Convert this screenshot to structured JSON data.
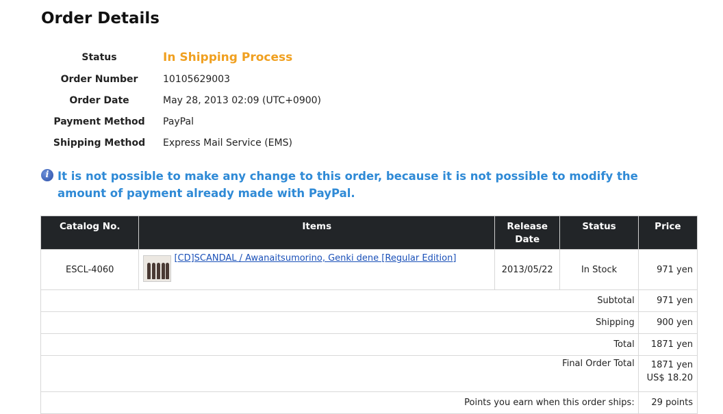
{
  "page": {
    "title": "Order Details"
  },
  "order": {
    "status_label": "Status",
    "status_value": "In Shipping Process",
    "number_label": "Order Number",
    "number_value": "10105629003",
    "date_label": "Order Date",
    "date_value": "May 28, 2013 02:09 (UTC+0900)",
    "payment_label": "Payment Method",
    "payment_value": "PayPal",
    "shipping_label": "Shipping Method",
    "shipping_value": "Express Mail Service (EMS)"
  },
  "notice": {
    "icon": "info-icon",
    "text": "It is not possible to make any change to this order, because it is not possible to modify the amount of payment already made with PayPal."
  },
  "table": {
    "headers": {
      "catalog": "Catalog No.",
      "items": "Items",
      "release_1": "Release",
      "release_2": "Date",
      "status": "Status",
      "price": "Price"
    },
    "items": [
      {
        "catalog": "ESCL-4060",
        "title": "[CD]SCANDAL / Awanaitsumorino, Genki dene [Regular Edition]",
        "release_date": "2013/05/22",
        "status": "In Stock",
        "price": "971 yen"
      }
    ],
    "summary": {
      "subtotal_label": "Subtotal",
      "subtotal_value": "971 yen",
      "shipping_label": "Shipping",
      "shipping_value": "900 yen",
      "total_label": "Total",
      "total_value": "1871 yen",
      "final_label": "Final Order Total",
      "final_value_yen": "1871 yen",
      "final_value_usd": "US$ 18.20",
      "points_label": "Points you earn when this order ships:",
      "points_value": "29 points"
    }
  },
  "colors": {
    "status": "#f0a020",
    "notice": "#2f8ad6",
    "header_bg": "#222528",
    "link": "#1a50b8"
  }
}
